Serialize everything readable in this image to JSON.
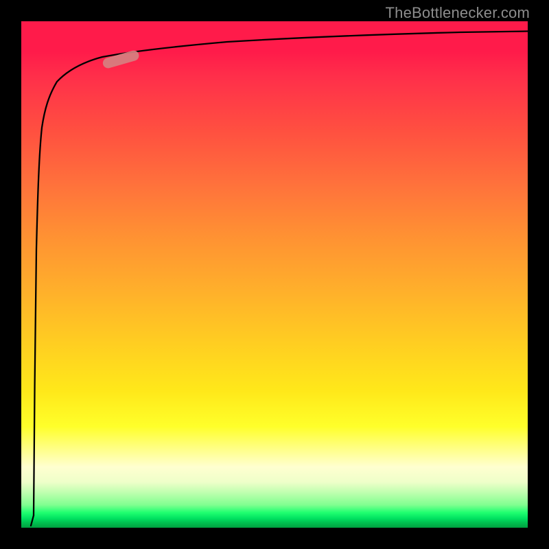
{
  "watermark": "TheBottlenecker.com",
  "colors": {
    "background": "#000000",
    "curve": "#000000",
    "marker": "#d68080",
    "gradient_top": "#ff1b4a",
    "gradient_bottom": "#00a040"
  },
  "chart_data": {
    "type": "line",
    "title": "",
    "xlabel": "",
    "ylabel": "",
    "xlim": [
      0,
      100
    ],
    "ylim": [
      0,
      100
    ],
    "x": [
      0,
      0.5,
      1,
      2,
      3,
      4,
      5,
      7,
      10,
      14,
      20,
      28,
      40,
      55,
      70,
      85,
      100
    ],
    "values": [
      0,
      30,
      55,
      74,
      82,
      86,
      88,
      90.5,
      92.3,
      93.5,
      94.5,
      95.3,
      96.1,
      96.7,
      97.2,
      97.6,
      98
    ],
    "marker": {
      "x_range": [
        14,
        22
      ],
      "y_range": [
        91,
        93
      ]
    },
    "annotations": []
  }
}
